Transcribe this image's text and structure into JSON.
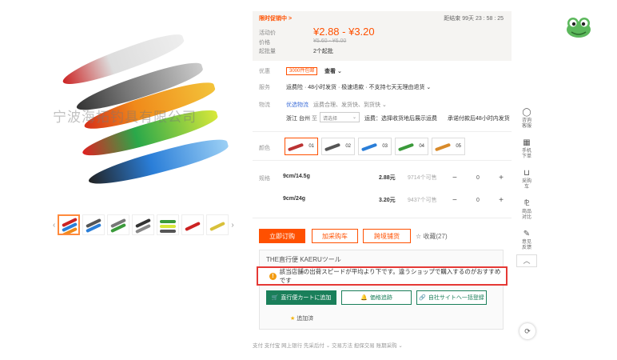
{
  "watermark": "宁波海拓钓具有限公司",
  "price_block": {
    "flash_label": "限时促销中 >",
    "timer": "距结束 99天 23 : 58 : 25",
    "price_label": "活动价",
    "price": "¥2.88 - ¥3.20",
    "orig_label": "价格",
    "orig_price": "¥5.60 - ¥6.00",
    "moq_label": "起批量",
    "moq": "2个起批"
  },
  "rows": {
    "youhui_label": "优惠",
    "coupon": "3000件包邮",
    "coupon_more": "查看 ⌄",
    "service_label": "服务",
    "service_text": "运费险 · 48小时发货 · 极速退款 · 不支持七天无理由退货 ⌄",
    "logistics_label": "物流",
    "logistics_tag": "优选物流",
    "logistics_text": "运费合理、发货快、到货快 ⌄",
    "from": "浙江 台州",
    "to_label": "至",
    "to_select": "请选择",
    "freight": "运费：选择收货地后展示运费",
    "ship_time": "承诺付款后48小时内发货",
    "color_label": "颜色",
    "spec_label": "规格"
  },
  "swatches": [
    {
      "label": "01",
      "color": "#b33"
    },
    {
      "label": "02",
      "color": "#555"
    },
    {
      "label": "03",
      "color": "#2a7ed8"
    },
    {
      "label": "04",
      "color": "#3a9a3a"
    },
    {
      "label": "05",
      "color": "#d88a2a"
    }
  ],
  "specs": [
    {
      "name": "9cm/14.5g",
      "price": "2.88元",
      "stock": "9714个可售",
      "qty": "0"
    },
    {
      "name": "9cm/24g",
      "price": "3.20元",
      "stock": "9437个可售",
      "qty": "0"
    }
  ],
  "buttons": {
    "order": "立即订购",
    "cart": "加采购车",
    "cross": "跨境铺货",
    "fav": "☆ 收藏(27)"
  },
  "plugin": {
    "title": "THE直行便 KAERUツール",
    "alert": "該当店舗の出荷スピードが平均より下です。違うショップで購入するのがおすすめです",
    "btn1": "直行便カートに追加",
    "btn2": "価格追跡",
    "btn3": "自社サイトへ一括登録",
    "fav": "追加済"
  },
  "sidebar": [
    {
      "icon": "◯",
      "label": "咨询客服"
    },
    {
      "icon": "▦",
      "label": "手机下单"
    },
    {
      "icon": "⊔",
      "label": "采购车"
    },
    {
      "icon": "⅊",
      "label": "商品对比"
    },
    {
      "icon": "✎",
      "label": "意见反馈"
    }
  ],
  "footer": "支付    支付宝  网上银行  先采后付 ⌄            交易方法   担保交易  账期采购 ⌄",
  "colors": {
    "accent": "#ff5000",
    "plugin_green": "#1a7f5a",
    "alert_red": "#e53935"
  }
}
